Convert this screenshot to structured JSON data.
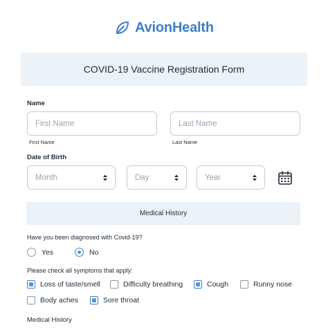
{
  "brand": {
    "name": "AvionHealth",
    "accent": "#3d7fc6"
  },
  "form": {
    "title": "COVID-19 Vaccine Registration Form"
  },
  "name_section": {
    "label": "Name",
    "first": {
      "placeholder": "First Name",
      "sublabel": "First Name",
      "value": ""
    },
    "last": {
      "placeholder": "Last Name",
      "sublabel": "Last Name",
      "value": ""
    }
  },
  "dob_section": {
    "label": "Date of Birth",
    "month": {
      "placeholder": "Month"
    },
    "day": {
      "placeholder": "Day"
    },
    "year": {
      "placeholder": "Year"
    },
    "calendar_icon": "calendar-icon"
  },
  "medical_history": {
    "title": "Medical History"
  },
  "diagnosed": {
    "question": "Have you been diagnosed with Covid-19?",
    "options": [
      {
        "label": "Yes",
        "selected": false
      },
      {
        "label": "No",
        "selected": true
      }
    ]
  },
  "symptoms": {
    "question": "Please check all symptoms that apply:",
    "options": [
      {
        "label": "Loss of taste/smell",
        "checked": true
      },
      {
        "label": "Difficulty breathing",
        "checked": false
      },
      {
        "label": "Cough",
        "checked": true
      },
      {
        "label": "Runny nose",
        "checked": false
      },
      {
        "label": "Body aches",
        "checked": false
      },
      {
        "label": "Sore throat",
        "checked": true
      }
    ]
  },
  "medical_history_field": {
    "label": "Medical History"
  }
}
